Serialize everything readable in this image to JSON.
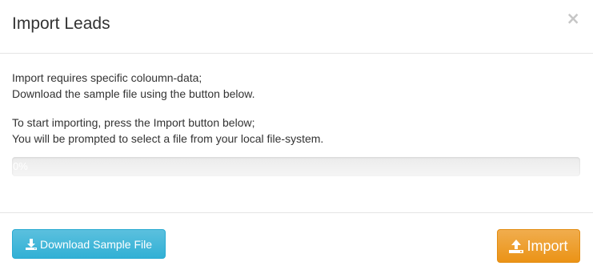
{
  "modal": {
    "title": "Import Leads",
    "close_label": "×"
  },
  "body": {
    "para1_line1": "Import requires specific coloumn-data;",
    "para1_line2": "Download the sample file using the button below.",
    "para2_line1": "To start importing, press the Import button below;",
    "para2_line2": "You will be prompted to select a file from your local file-system."
  },
  "progress": {
    "value": 0,
    "label": "0%"
  },
  "footer": {
    "download_label": "Download Sample File",
    "import_label": "Import"
  },
  "icons": {
    "download": "download-icon",
    "upload": "upload-icon"
  },
  "colors": {
    "info": "#5bc0de",
    "warning": "#f0ad4e",
    "progress": "#337ab7"
  }
}
